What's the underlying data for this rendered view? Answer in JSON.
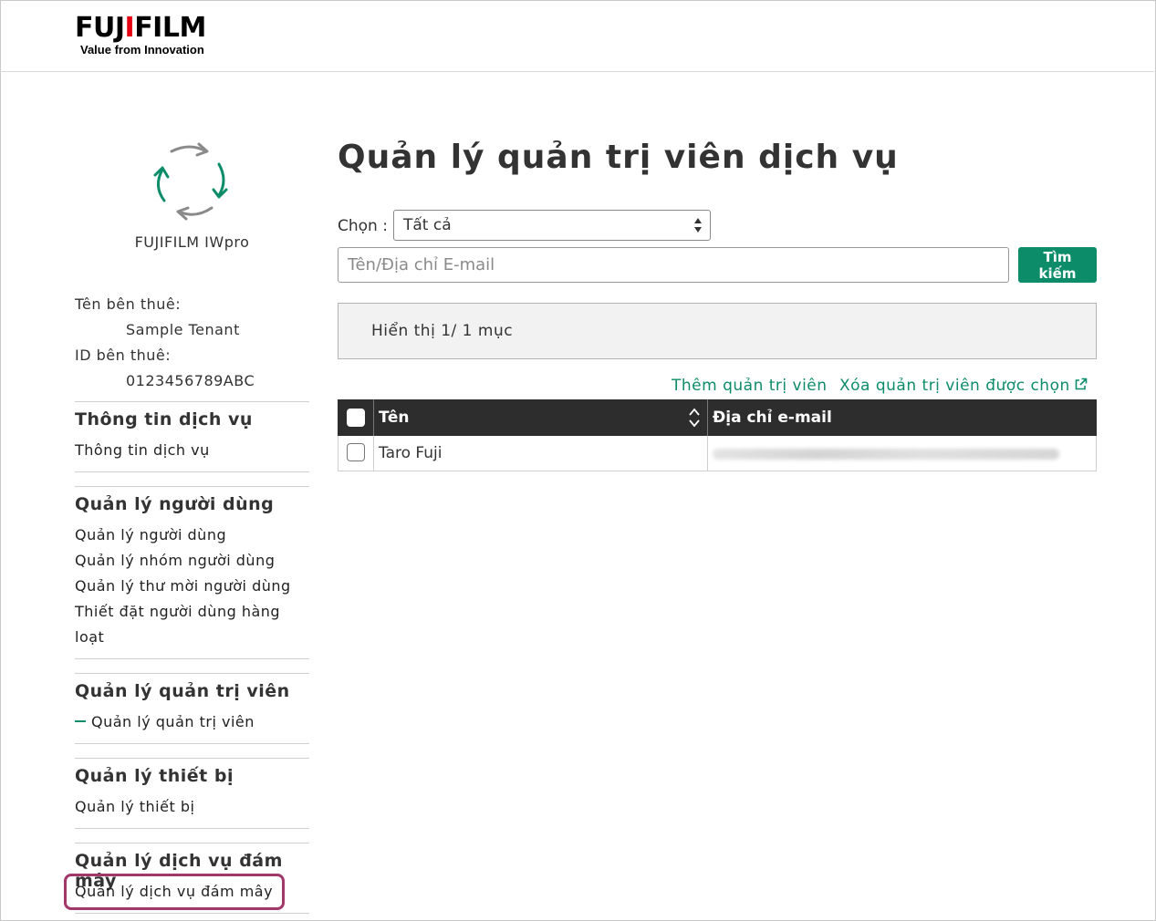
{
  "header": {
    "brand": "FUJIFILM",
    "tagline": "Value from Innovation"
  },
  "sidebar": {
    "app_name": "FUJIFILM IWpro",
    "tenant_name_label": "Tên bên thuê:",
    "tenant_name": "Sample Tenant",
    "tenant_id_label": "ID bên thuê:",
    "tenant_id": "0123456789ABC",
    "sections": [
      {
        "heading": "Thông tin dịch vụ",
        "items": [
          "Thông tin dịch vụ"
        ]
      },
      {
        "heading": "Quản lý người dùng",
        "items": [
          "Quản lý người dùng",
          "Quản lý nhóm người dùng",
          "Quản lý thư mời người dùng",
          "Thiết đặt người dùng hàng",
          "loạt"
        ]
      },
      {
        "heading": "Quản lý quản trị viên",
        "items": [
          "Quản lý quản trị viên"
        ]
      },
      {
        "heading": "Quản lý thiết bị",
        "items": [
          "Quản lý thiết bị"
        ]
      },
      {
        "heading": "Quản lý dịch vụ đám mây",
        "items": [
          "Quản lý dịch vụ đám mây"
        ]
      }
    ],
    "active_item": "Quản lý quản trị viên",
    "highlight_color": "#a2386a"
  },
  "main": {
    "title": "Quản lý quản trị viên dịch vụ",
    "filter_label": "Chọn :",
    "filter_value": "Tất cả",
    "search_placeholder": "Tên/Địa chỉ E-mail",
    "search_button": "Tìm kiếm",
    "result_text": "Hiển thị 1/ 1 mục",
    "add_link": "Thêm quản trị viên",
    "delete_link": "Xóa quản trị viên được chọn",
    "table": {
      "columns": [
        "Tên",
        "Địa chỉ e-mail"
      ],
      "rows": [
        {
          "name": "Taro Fuji",
          "email": ""
        }
      ]
    }
  },
  "colors": {
    "accent": "#0d8c6a",
    "table_header": "#2d2d2d",
    "brand_red": "#e60012"
  }
}
